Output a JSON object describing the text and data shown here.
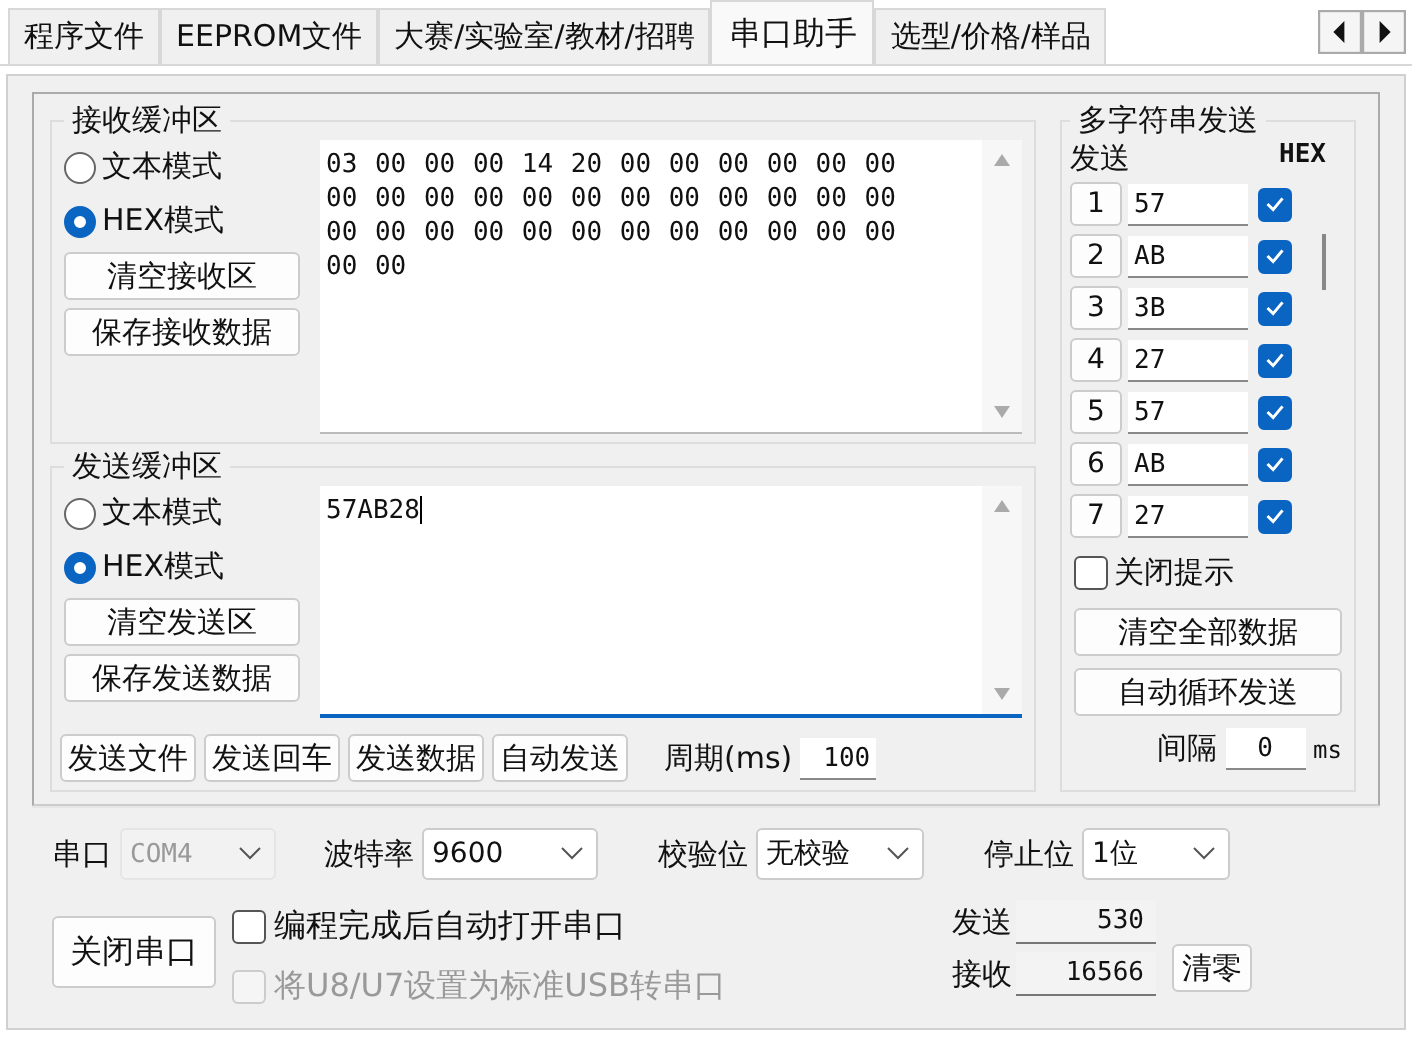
{
  "tabs": [
    {
      "label": "程序文件",
      "selected": false
    },
    {
      "label": "EEPROM文件",
      "selected": false
    },
    {
      "label": "大赛/实验室/教材/招聘",
      "selected": false
    },
    {
      "label": "串口助手",
      "selected": true
    },
    {
      "label": "选型/价格/样品",
      "selected": false
    }
  ],
  "receive": {
    "title": "接收缓冲区",
    "modes": [
      {
        "label": "文本模式",
        "selected": false
      },
      {
        "label": "HEX模式",
        "selected": true
      }
    ],
    "buttons": [
      "清空接收区",
      "保存接收数据"
    ],
    "content": "03 00 00 00 14 20 00 00 00 00 00 00 00 00 00 00 00 00 00 00 00 00 00 00 00 00 00 00 00 00 00 00 00 00 00 00 00 00"
  },
  "send": {
    "title": "发送缓冲区",
    "modes": [
      {
        "label": "文本模式",
        "selected": false
      },
      {
        "label": "HEX模式",
        "selected": true
      }
    ],
    "buttons": [
      "清空发送区",
      "保存发送数据"
    ],
    "value": "57AB28",
    "actions": [
      "发送文件",
      "发送回车",
      "发送数据",
      "自动发送"
    ],
    "period_label": "周期(ms)",
    "period_value": "100"
  },
  "multi": {
    "title": "多字符串发送",
    "header_send": "发送",
    "header_hex": "HEX",
    "rows": [
      {
        "index": "1",
        "value": "57",
        "hex": true
      },
      {
        "index": "2",
        "value": "AB",
        "hex": true
      },
      {
        "index": "3",
        "value": "3B",
        "hex": true
      },
      {
        "index": "4",
        "value": "27",
        "hex": true
      },
      {
        "index": "5",
        "value": "57",
        "hex": true
      },
      {
        "index": "6",
        "value": "AB",
        "hex": true
      },
      {
        "index": "7",
        "value": "27",
        "hex": true
      }
    ],
    "close_hint": {
      "label": "关闭提示",
      "checked": false
    },
    "buttons": [
      "清空全部数据",
      "自动循环发送"
    ],
    "interval_label": "间隔",
    "interval_value": "0",
    "interval_unit": "ms"
  },
  "settings": [
    {
      "label": "串口",
      "value": "COM4",
      "disabled": true
    },
    {
      "label": "波特率",
      "value": "9600",
      "disabled": false
    },
    {
      "label": "校验位",
      "value": "无校验",
      "disabled": false
    },
    {
      "label": "停止位",
      "value": "1位",
      "disabled": false
    }
  ],
  "close_button": "关闭串口",
  "options": [
    {
      "label": "编程完成后自动打开串口",
      "checked": false,
      "disabled": false
    },
    {
      "label": "将U8/U7设置为标准USB转串口",
      "checked": false,
      "disabled": true
    }
  ],
  "counters": [
    {
      "label": "发送",
      "value": "530"
    },
    {
      "label": "接收",
      "value": "16566"
    }
  ],
  "clear_button": "清零"
}
